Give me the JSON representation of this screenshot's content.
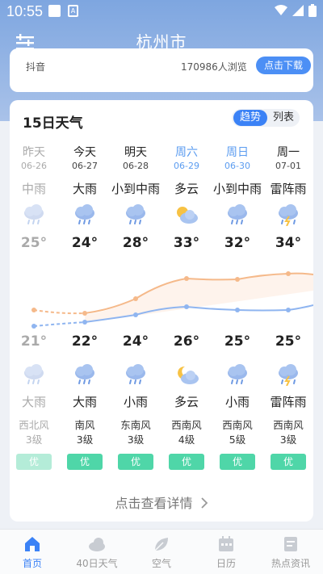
{
  "status_bar": {
    "time": "10:55"
  },
  "header": {
    "city": "杭州市"
  },
  "prev_card": {
    "source": "抖音",
    "views": "170986人浏览",
    "button": "点击下载"
  },
  "forecast": {
    "title": "15日天气",
    "toggle": {
      "active": "趋势",
      "inactive": "列表"
    },
    "days": [
      {
        "name": "昨天",
        "date": "06-26",
        "day_cond": "中雨",
        "day_icon": "rain-icon",
        "high": "25°",
        "low": "21°",
        "night_icon": "rain-icon",
        "night_cond": "大雨",
        "wind_dir": "西北风",
        "wind_lvl": "3级",
        "aqi": "优"
      },
      {
        "name": "今天",
        "date": "06-27",
        "day_cond": "大雨",
        "day_icon": "rain-icon",
        "high": "24°",
        "low": "22°",
        "night_icon": "rain-icon",
        "night_cond": "大雨",
        "wind_dir": "南风",
        "wind_lvl": "3级",
        "aqi": "优"
      },
      {
        "name": "明天",
        "date": "06-28",
        "day_cond": "小到中雨",
        "day_icon": "rain-icon",
        "high": "28°",
        "low": "24°",
        "night_icon": "rain-icon",
        "night_cond": "小雨",
        "wind_dir": "东南风",
        "wind_lvl": "3级",
        "aqi": "优"
      },
      {
        "name": "周六",
        "date": "06-29",
        "day_cond": "多云",
        "day_icon": "partly-cloudy-icon",
        "high": "33°",
        "low": "26°",
        "night_icon": "cloudy-night-icon",
        "night_cond": "多云",
        "wind_dir": "西南风",
        "wind_lvl": "4级",
        "aqi": "优"
      },
      {
        "name": "周日",
        "date": "06-30",
        "day_cond": "小到中雨",
        "day_icon": "rain-icon",
        "high": "32°",
        "low": "25°",
        "night_icon": "rain-icon",
        "night_cond": "小雨",
        "wind_dir": "西南风",
        "wind_lvl": "5级",
        "aqi": "优"
      },
      {
        "name": "周一",
        "date": "07-01",
        "day_cond": "雷阵雨",
        "day_icon": "thunderstorm-icon",
        "high": "34°",
        "low": "25°",
        "night_icon": "thunderstorm-icon",
        "night_cond": "雷阵雨",
        "wind_dir": "西南风",
        "wind_lvl": "3级",
        "aqi": "优"
      }
    ],
    "detail_link": "点击查看详情"
  },
  "nav": [
    {
      "label": "首页",
      "icon": "home-icon",
      "active": true
    },
    {
      "label": "40日天气",
      "icon": "cloud-icon",
      "active": false
    },
    {
      "label": "空气",
      "icon": "leaf-icon",
      "active": false
    },
    {
      "label": "日历",
      "icon": "calendar-icon",
      "active": false
    },
    {
      "label": "热点资讯",
      "icon": "news-icon",
      "active": false
    }
  ],
  "colors": {
    "accent": "#3b82f6",
    "high_line": "#f5b98a",
    "low_line": "#8fb5f0",
    "aqi_good": "#4fd6a8"
  }
}
